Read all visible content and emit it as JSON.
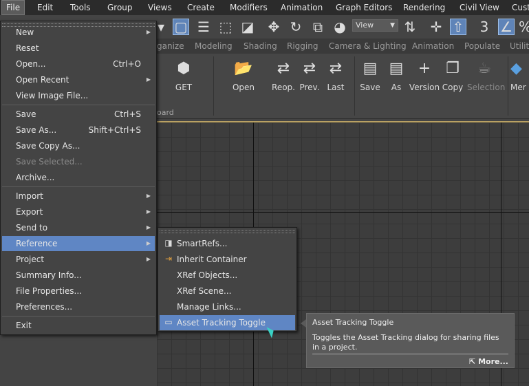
{
  "menubar": [
    "File",
    "Edit",
    "Tools",
    "Group",
    "Views",
    "Create",
    "Modifiers",
    "Animation",
    "Graph Editors",
    "Rendering",
    "Civil View",
    "Cust"
  ],
  "toolbar": {
    "view_dropdown": "View",
    "snaps_label": "3"
  },
  "tabs": [
    "ganize",
    "Modeling",
    "Shading",
    "Rigging",
    "Camera & Lighting",
    "Animation",
    "Populate",
    "Utiliti"
  ],
  "ribbon": {
    "get": "GET",
    "footer": "oard",
    "buttons": [
      "Open",
      "Reop.",
      "Prev.",
      "Last",
      "Save",
      "As",
      "Version",
      "Copy",
      "Selection",
      "Mer"
    ]
  },
  "file_menu": {
    "items": [
      {
        "label": "New",
        "shortcut": "",
        "arrow": true
      },
      {
        "label": "Reset",
        "shortcut": ""
      },
      {
        "label": "Open...",
        "shortcut": "Ctrl+O"
      },
      {
        "label": "Open Recent",
        "shortcut": "",
        "arrow": true
      },
      {
        "label": "View Image File...",
        "shortcut": ""
      },
      {
        "label": "Save",
        "shortcut": "Ctrl+S"
      },
      {
        "label": "Save As...",
        "shortcut": "Shift+Ctrl+S"
      },
      {
        "label": "Save Copy As...",
        "shortcut": ""
      },
      {
        "label": "Save Selected...",
        "shortcut": "",
        "disabled": true
      },
      {
        "label": "Archive...",
        "shortcut": ""
      },
      {
        "label": "Import",
        "shortcut": "",
        "arrow": true
      },
      {
        "label": "Export",
        "shortcut": "",
        "arrow": true
      },
      {
        "label": "Send to",
        "shortcut": "",
        "arrow": true
      },
      {
        "label": "Reference",
        "shortcut": "",
        "arrow": true,
        "highlight": true
      },
      {
        "label": "Project",
        "shortcut": "",
        "arrow": true
      },
      {
        "label": "Summary Info...",
        "shortcut": ""
      },
      {
        "label": "File Properties...",
        "shortcut": ""
      },
      {
        "label": "Preferences...",
        "shortcut": ""
      },
      {
        "label": "Exit",
        "shortcut": ""
      }
    ]
  },
  "reference_menu": {
    "items": [
      {
        "label": "SmartRefs...",
        "icon": "smartrefs-icon"
      },
      {
        "label": "Inherit Container",
        "icon": "container-icon"
      },
      {
        "label": "XRef Objects...",
        "icon": ""
      },
      {
        "label": "XRef Scene...",
        "icon": ""
      },
      {
        "label": "Manage Links...",
        "icon": ""
      },
      {
        "label": "Asset Tracking Toggle",
        "icon": "asset-tracking-icon",
        "highlight": true
      }
    ]
  },
  "tooltip": {
    "title": "Asset Tracking Toggle",
    "description": "Toggles the Asset Tracking dialog for sharing files in a project.",
    "more": "More..."
  }
}
